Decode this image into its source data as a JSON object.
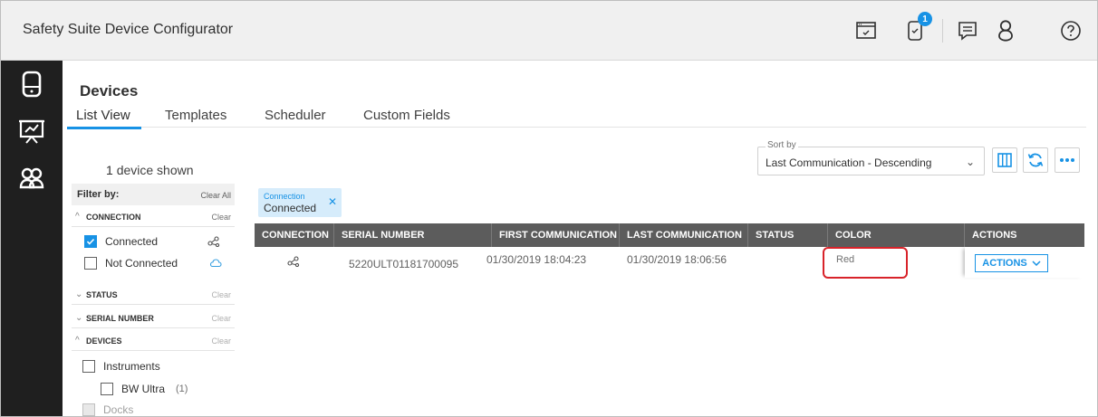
{
  "app": {
    "title": "Safety Suite Device Configurator"
  },
  "header": {
    "icons": [
      "browser-window-icon",
      "device-notification-icon",
      "chat-icon",
      "user-icon",
      "help-icon"
    ],
    "notification_count": "1"
  },
  "rail": {
    "items": [
      "device-icon",
      "chart-presentation-icon",
      "users-group-icon"
    ]
  },
  "page": {
    "title": "Devices",
    "tabs": [
      {
        "label": "List View",
        "active": true
      },
      {
        "label": "Templates",
        "active": false
      },
      {
        "label": "Scheduler",
        "active": false
      },
      {
        "label": "Custom Fields",
        "active": false
      }
    ],
    "device_count": "1",
    "device_count_suffix": "device shown"
  },
  "filters": {
    "header": "Filter by:",
    "clear_all": "Clear All",
    "sections": [
      {
        "label": "CONNECTION",
        "clear": "Clear",
        "expanded": true,
        "options": [
          {
            "label": "Connected",
            "checked": true
          },
          {
            "label": "Not Connected",
            "checked": false
          }
        ]
      },
      {
        "label": "STATUS",
        "clear": "Clear",
        "expanded": false
      },
      {
        "label": "SERIAL NUMBER",
        "clear": "Clear",
        "expanded": false
      },
      {
        "label": "DEVICES",
        "clear": "Clear",
        "expanded": true,
        "options": [
          {
            "label": "Instruments",
            "checked": false
          },
          {
            "label": "BW Ultra",
            "count": "(1)",
            "checked": false
          },
          {
            "label": "Docks",
            "checked": false,
            "disabled": true
          }
        ]
      }
    ]
  },
  "sort": {
    "legend": "Sort by",
    "value": "Last Communication - Descending"
  },
  "chip": {
    "category": "Connection",
    "value": "Connected"
  },
  "table": {
    "columns": [
      "CONNECTION",
      "SERIAL NUMBER",
      "FIRST COMMUNICATION",
      "LAST COMMUNICATION",
      "STATUS",
      "COLOR",
      "ACTIONS"
    ],
    "rows": [
      {
        "connection_icon": "connected-icon",
        "serial": "5220ULT01181700095",
        "first": "01/30/2019 18:04:23",
        "last": "01/30/2019 18:06:56",
        "status": "",
        "color": "Red",
        "actions": "ACTIONS"
      }
    ]
  },
  "colors": {
    "accent": "#1792e5",
    "rail": "#1f1f1f",
    "table_header": "#5c5c5c",
    "highlight": "#d8232a"
  }
}
